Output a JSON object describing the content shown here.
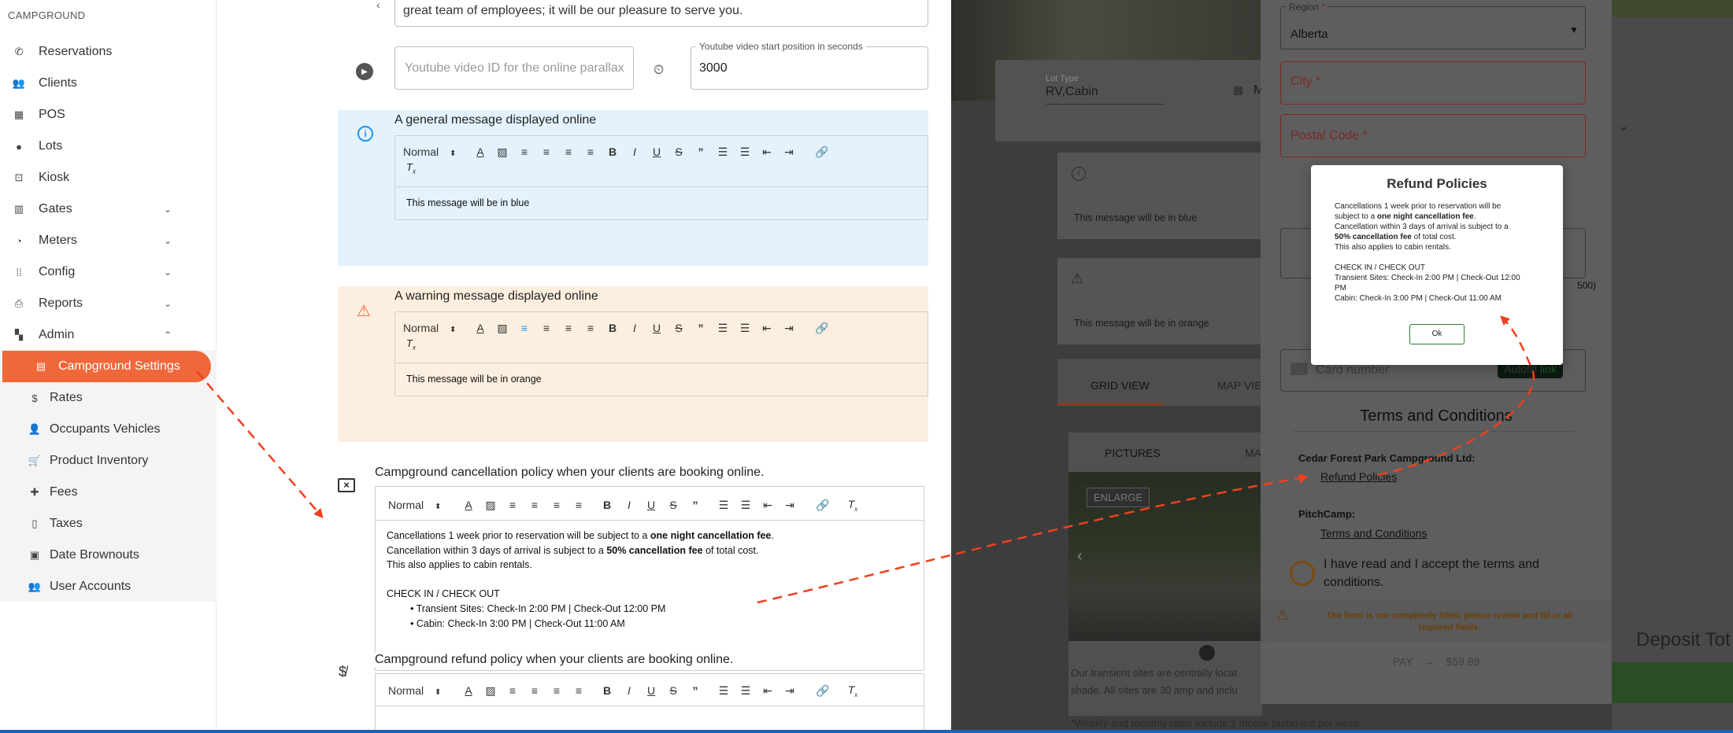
{
  "sidebar": {
    "brand": "CAMPGROUND",
    "items": [
      {
        "label": "Reservations",
        "icon": "phone-icon"
      },
      {
        "label": "Clients",
        "icon": "people-icon"
      },
      {
        "label": "POS",
        "icon": "store-icon"
      },
      {
        "label": "Lots",
        "icon": "pin-icon"
      },
      {
        "label": "Kiosk",
        "icon": "kiosk-icon"
      },
      {
        "label": "Gates",
        "icon": "gate-icon"
      },
      {
        "label": "Meters",
        "icon": "gauge-icon"
      },
      {
        "label": "Config",
        "icon": "grid-icon"
      },
      {
        "label": "Reports",
        "icon": "printer-icon"
      },
      {
        "label": "Admin",
        "icon": "dashboard-icon"
      }
    ],
    "admin_items": [
      {
        "label": "Campground Settings",
        "icon": "storefront-icon"
      },
      {
        "label": "Rates",
        "icon": "dollar-icon"
      },
      {
        "label": "Occupants Vehicles",
        "icon": "person-add-icon"
      },
      {
        "label": "Product Inventory",
        "icon": "cart-icon"
      },
      {
        "label": "Fees",
        "icon": "puzzle-icon"
      },
      {
        "label": "Taxes",
        "icon": "receipt-icon"
      },
      {
        "label": "Date Brownouts",
        "icon": "calendar-icon"
      },
      {
        "label": "User Accounts",
        "icon": "group-icon"
      }
    ]
  },
  "main": {
    "intro_text": "great team of employees; it will be our pleasure to serve you.",
    "youtube_placeholder": "Youtube video ID for the online parallax",
    "youtube_start_label": "Youtube video start position in seconds",
    "youtube_start_value": "3000",
    "general_title": "A general message displayed online",
    "general_text": "This message will be in blue",
    "warning_title": "A warning message displayed online",
    "warning_text": "This message will be in orange",
    "format_normal": "Normal",
    "cancel_title": "Campground cancellation policy when your clients are booking online.",
    "refund_title": "Campground refund policy when your clients are booking online.",
    "policy": {
      "line1_a": "Cancellations 1 week prior to reservation will be subject to a ",
      "line1_b": "one night cancellation fee",
      "line1_c": ".",
      "line2_a": "Cancellation within 3 days of arrival is subject to a ",
      "line2_b": "50% cancellation fee",
      "line2_c": " of total cost.",
      "line3": "This also applies to cabin rentals.",
      "line4": "CHECK IN / CHECK OUT",
      "bullet1": "Transient Sites: Check-In 2:00 PM | Check-Out 12:00 PM",
      "bullet2": "Cabin: Check-In 3:00 PM | Check-Out 11:00 AM"
    }
  },
  "preview": {
    "lot_type_label": "Lot Type",
    "lot_type_value": "RV,Cabin",
    "lot_extra": "M",
    "blue_text": "This message will be in blue",
    "orange_text": "This message will be in orange",
    "tab_grid": "GRID VIEW",
    "tab_map": "MAP VIE",
    "tab_pictures": "PICTURES",
    "tab_ma": "MA",
    "enlarge": "ENLARGE",
    "desc1": "Our transient sites are centrally locat",
    "desc2": "shade. All sites are 30 amp and inclu",
    "desc3": "*Weekly and monthly rates include 1 mobile pump-out per week.",
    "deposit": "Deposit Tot",
    "char_count": "500)"
  },
  "dialog": {
    "region_label": "Region",
    "region_value": "Alberta",
    "city_label": "City",
    "postal_label": "Postal Code",
    "card_placeholder": "Card number",
    "autofill_a": "Autofill",
    "autofill_b": "link",
    "terms_heading": "Terms and Conditions",
    "cedar_label": "Cedar Forest Park Campground Ltd:",
    "refund_link": "Refund Policies",
    "pitchcamp_label": "PitchCamp:",
    "terms_link": "Terms and Conditions",
    "accept_text_1": "I have read and I accept the terms and",
    "accept_text_2": "conditions.",
    "warning_1": "The form is not completely filled, please review and fill in all",
    "warning_2": "required fields.",
    "pay_label": "PAY",
    "pay_amount": "$59.89"
  },
  "modal": {
    "title": "Refund Policies",
    "l1_a": "Cancellations 1 week prior to reservation will be",
    "l1_b": "subject to a ",
    "l1_bold": "one night cancellation fee",
    "l1_c": ".",
    "l2": "Cancellation within 3 days of arrival is subject to a",
    "l3_bold": "50% cancellation fee",
    "l3_c": " of total cost.",
    "l4": "This also applies to cabin rentals.",
    "l5": "CHECK IN / CHECK OUT",
    "l6": "Transient Sites: Check-In 2:00 PM | Check-Out 12:00",
    "l7": "PM",
    "l8": "Cabin: Check-In 3:00 PM | Check-Out 11:00 AM",
    "ok": "Ok"
  },
  "colors": {
    "accent": "#f0673a",
    "blue_panel": "#e3f2fd",
    "orange_panel": "#fdefdf",
    "error_red": "#e85a4f",
    "arrow_red": "#f0401e"
  }
}
